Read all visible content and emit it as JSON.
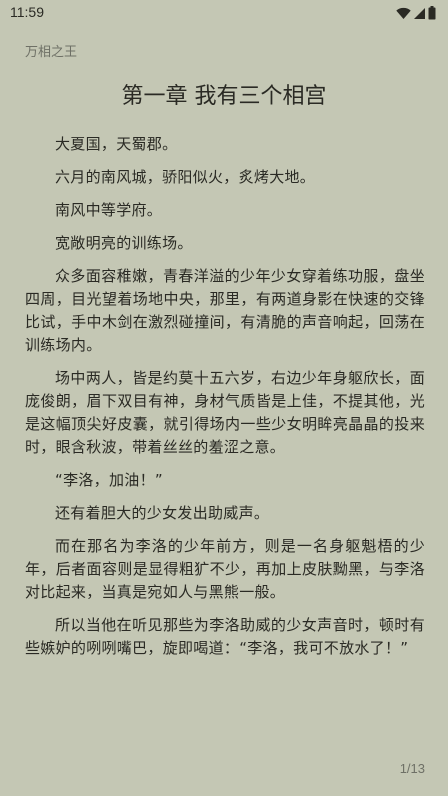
{
  "status_bar": {
    "time": "11:59",
    "icons": [
      "wifi-icon",
      "cellular-signal-icon",
      "battery-icon"
    ]
  },
  "reader": {
    "book_title": "万相之王",
    "chapter_title": "第一章 我有三个相宫",
    "paragraphs": [
      "大夏国，天蜀郡。",
      "六月的南风城，骄阳似火，炙烤大地。",
      "南风中等学府。",
      "宽敞明亮的训练场。",
      "众多面容稚嫩，青春洋溢的少年少女穿着练功服，盘坐四周，目光望着场地中央，那里，有两道身影在快速的交锋比试，手中木剑在激烈碰撞间，有清脆的声音响起，回荡在训练场内。",
      "场中两人，皆是约莫十五六岁，右边少年身躯欣长，面庞俊朗，眉下双目有神，身材气质皆是上佳，不提其他，光是这幅顶尖好皮囊，就引得场内一些少女明眸亮晶晶的投来时，眼含秋波，带着丝丝的羞涩之意。",
      "“李洛，加油！”",
      "还有着胆大的少女发出助威声。",
      "而在那名为李洛的少年前方，则是一名身躯魁梧的少年，后者面容则是显得粗犷不少，再加上皮肤黝黑，与李洛对比起来，当真是宛如人与黑熊一般。",
      "所以当他在听见那些为李洛助威的少女声音时，顿时有些嫉妒的咧咧嘴巴，旋即喝道：“李洛，我可不放水了！”"
    ],
    "page_indicator": "1/13"
  },
  "colors": {
    "background": "#c4c7b4",
    "text": "#2a2a24",
    "muted_text": "#6e7066"
  }
}
